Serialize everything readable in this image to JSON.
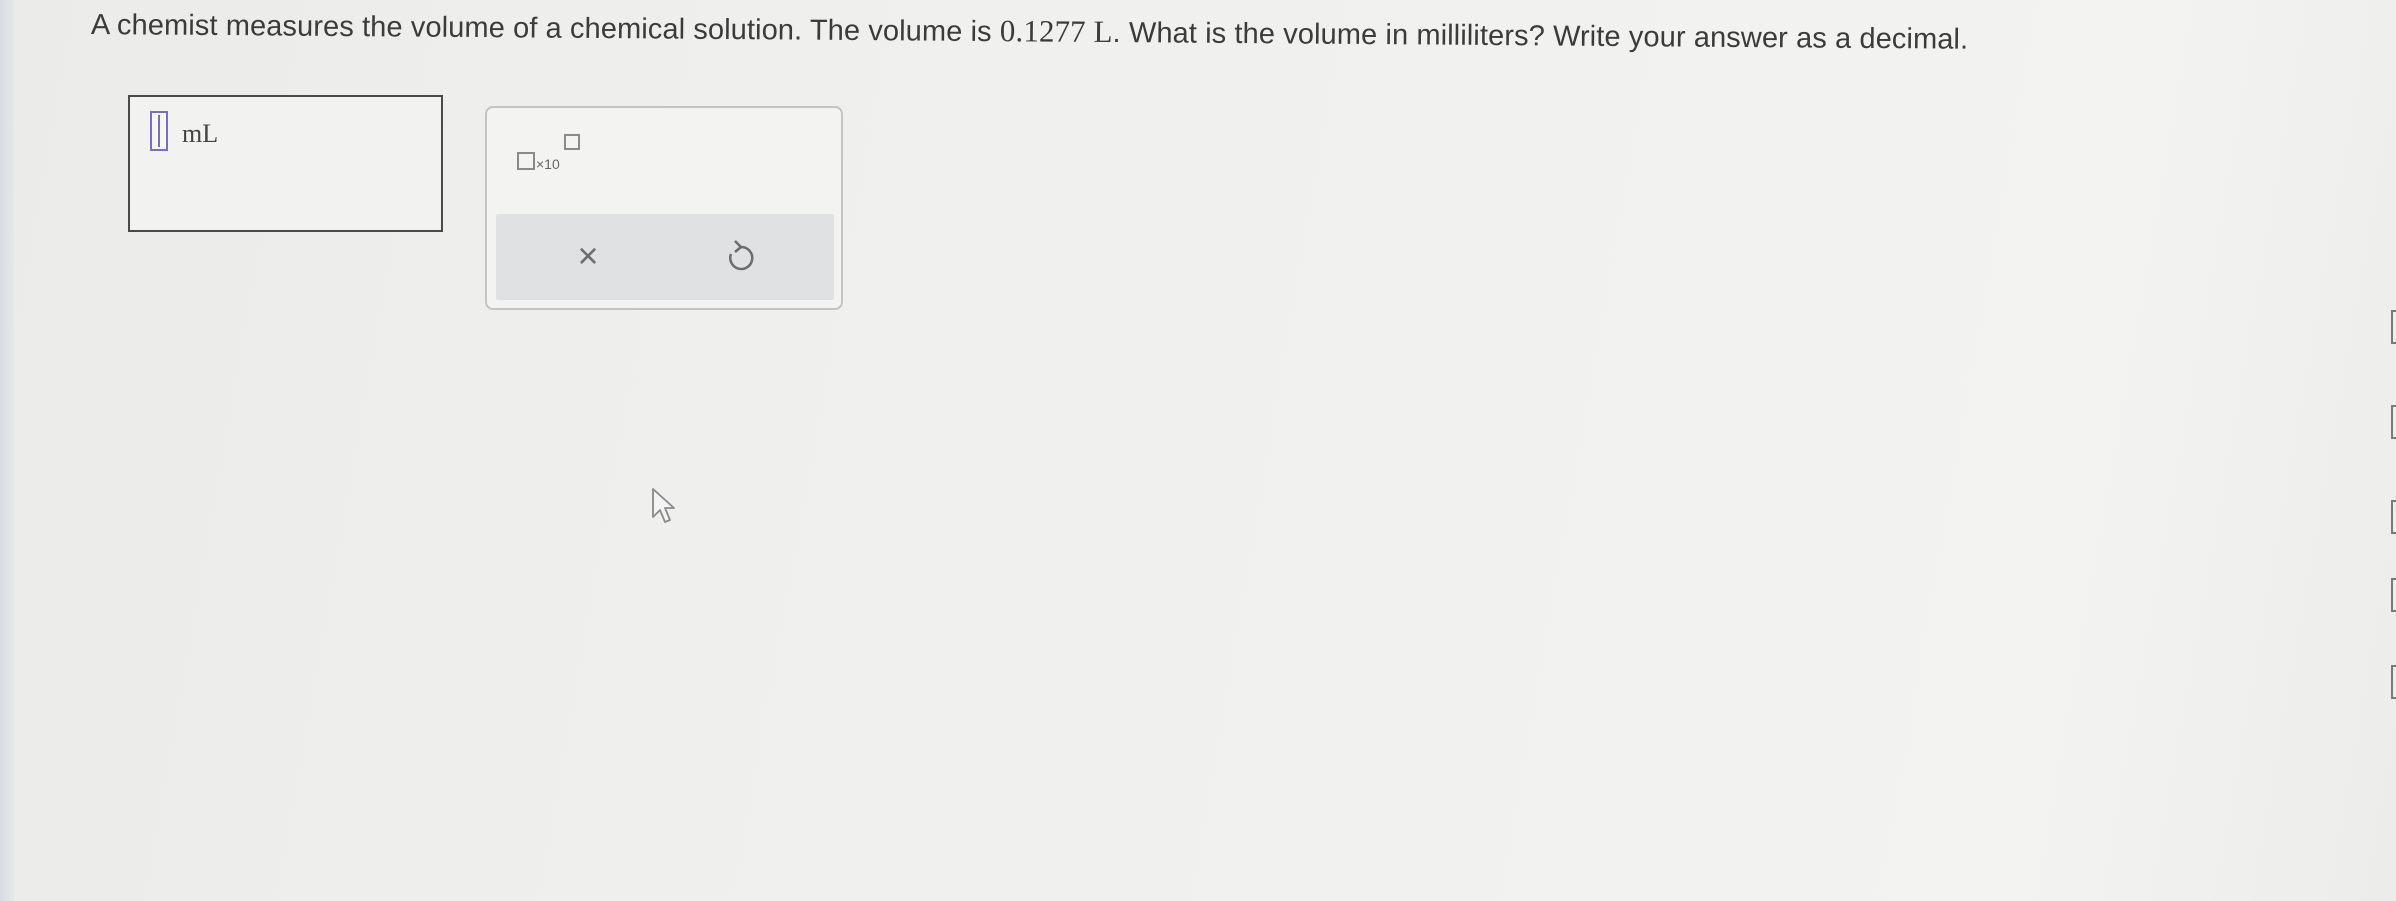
{
  "question": {
    "part1": "A chemist measures the volume of a chemical solution. The volume is ",
    "value": "0.1277 L",
    "part2": ". What is the volume in milliliters? Write your answer as a decimal."
  },
  "answer": {
    "value": "",
    "unit": "mL"
  },
  "toolbox": {
    "sci_notation_label": "×10",
    "clear_symbol": "×"
  },
  "colors": {
    "input_accent": "#7a6fb8",
    "action_bar": "#e0e1e2"
  },
  "icons": {
    "scientific_notation": "box-times-ten-superscript-box",
    "clear": "x-icon",
    "undo": "undo-arrow-icon",
    "cursor": "mouse-pointer-arrow"
  }
}
